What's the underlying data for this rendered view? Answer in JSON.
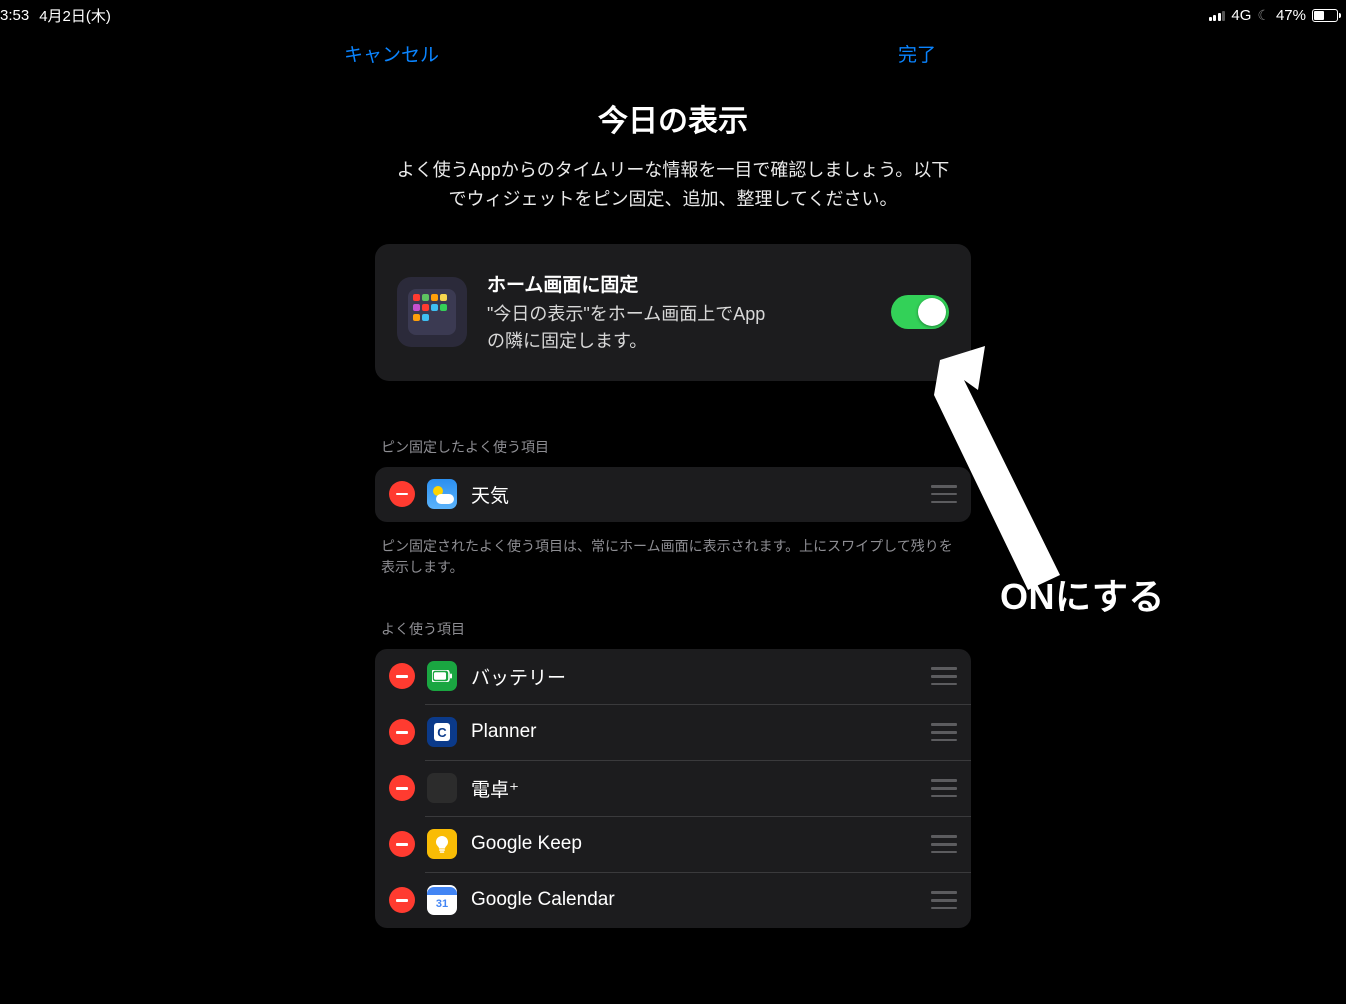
{
  "status": {
    "time": "3:53",
    "date": "4月2日(木)",
    "network": "4G",
    "battery_percent": "47%"
  },
  "nav": {
    "cancel": "キャンセル",
    "done": "完了"
  },
  "page": {
    "title": "今日の表示",
    "subtitle": "よく使うAppからのタイムリーな情報を一目で確認しましょう。以下でウィジェットをピン固定、追加、整理してください。"
  },
  "pin_card": {
    "title": "ホーム画面に固定",
    "descA": "\"今日の表示\"をホーム画面上でApp",
    "descB": "の隣に固定します。",
    "toggle_on": true
  },
  "sections": {
    "pinned_header": "ピン固定したよく使う項目",
    "pinned_footer": "ピン固定されたよく使う項目は、常にホーム画面に表示されます。上にスワイプして残りを表示します。",
    "favorites_header": "よく使う項目"
  },
  "pinned_items": [
    {
      "label": "天気",
      "icon": "weather"
    }
  ],
  "favorite_items": [
    {
      "label": "バッテリー",
      "icon": "battery"
    },
    {
      "label": "Planner",
      "icon": "planner"
    },
    {
      "label": "電卓⁺",
      "icon": "calc"
    },
    {
      "label": "Google Keep",
      "icon": "keep"
    },
    {
      "label": "Google Calendar",
      "icon": "calendar",
      "calendar_num": "31"
    }
  ],
  "annotation": {
    "label": "ONにする"
  }
}
